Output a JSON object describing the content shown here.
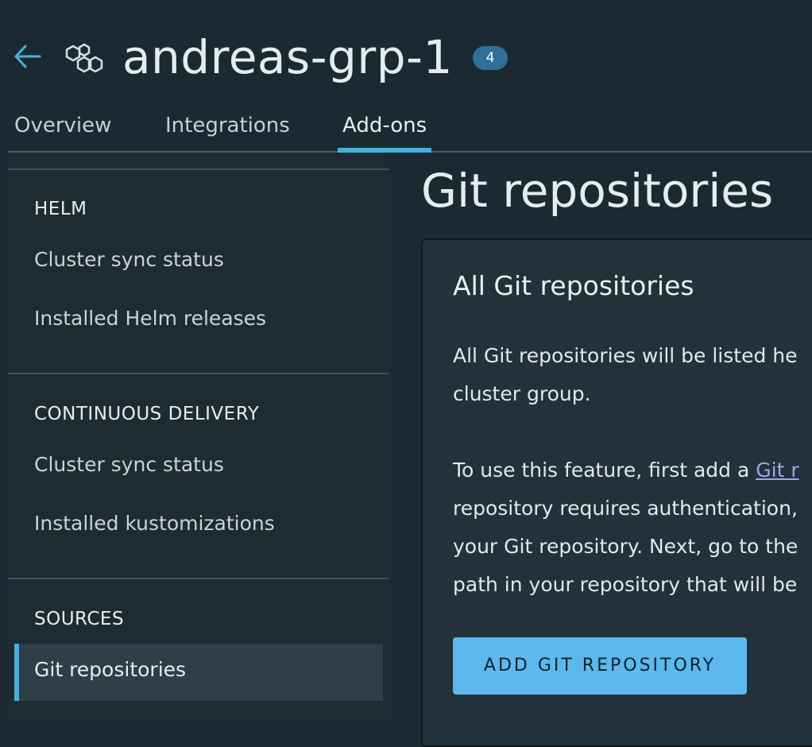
{
  "header": {
    "back_icon": "arrow-left-icon",
    "group_icon": "cluster-group-icon",
    "title": "andreas-grp-1",
    "count_badge": "4"
  },
  "tabs": [
    {
      "label": "Overview",
      "active": false
    },
    {
      "label": "Integrations",
      "active": false
    },
    {
      "label": "Add-ons",
      "active": true
    }
  ],
  "sidebar": {
    "sections": [
      {
        "heading": "HELM",
        "items": [
          "Cluster sync status",
          "Installed Helm releases"
        ]
      },
      {
        "heading": "CONTINUOUS DELIVERY",
        "items": [
          "Cluster sync status",
          "Installed kustomizations"
        ]
      },
      {
        "heading": "SOURCES",
        "items": [
          "Git repositories"
        ]
      }
    ],
    "selected_item": "Git repositories"
  },
  "main": {
    "page_title": "Git repositories",
    "card": {
      "title": "All Git repositories",
      "para1_line1": "All Git repositories will be listed he",
      "para1_line2": "cluster group.",
      "para2_line1_prefix": "To use this feature, first add a ",
      "para2_link": "Git r",
      "para2_line2": "repository requires authentication,",
      "para2_line3": "your Git repository. Next, go to the",
      "para2_line4": "path in your repository that will be",
      "button_label": "ADD GIT REPOSITORY"
    }
  },
  "colors": {
    "background": "#1b2a32",
    "sidebar": "#1f2b33",
    "accent": "#49afd9",
    "button": "#5cb8ef",
    "badge": "#2f6f99",
    "link": "#9ea7e8"
  }
}
